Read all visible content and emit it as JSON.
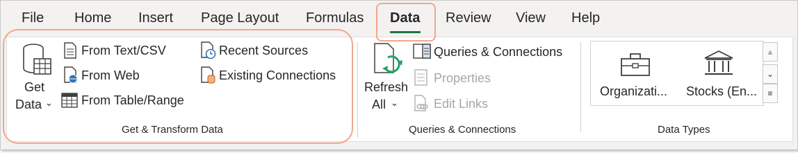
{
  "tabs": [
    {
      "label": "File"
    },
    {
      "label": "Home"
    },
    {
      "label": "Insert"
    },
    {
      "label": "Page Layout"
    },
    {
      "label": "Formulas"
    },
    {
      "label": "Data"
    },
    {
      "label": "Review"
    },
    {
      "label": "View"
    },
    {
      "label": "Help"
    }
  ],
  "active_tab": "Data",
  "get_transform": {
    "get_data_line1": "Get",
    "get_data_line2": "Data",
    "from_text_csv": "From Text/CSV",
    "from_web": "From Web",
    "from_table_range": "From Table/Range",
    "recent_sources": "Recent Sources",
    "existing_connections": "Existing Connections",
    "group_label": "Get & Transform Data"
  },
  "queries": {
    "refresh_line1": "Refresh",
    "refresh_line2": "All",
    "queries_connections": "Queries & Connections",
    "properties": "Properties",
    "edit_links": "Edit Links",
    "group_label": "Queries & Connections"
  },
  "data_types": {
    "items": [
      {
        "label": "Organizati...",
        "icon": "briefcase-icon"
      },
      {
        "label": "Stocks (En...",
        "icon": "bank-icon"
      }
    ],
    "group_label": "Data Types"
  },
  "colors": {
    "accent": "#217346",
    "highlight": "#f0a78c",
    "disabled": "#a6a6a6"
  }
}
